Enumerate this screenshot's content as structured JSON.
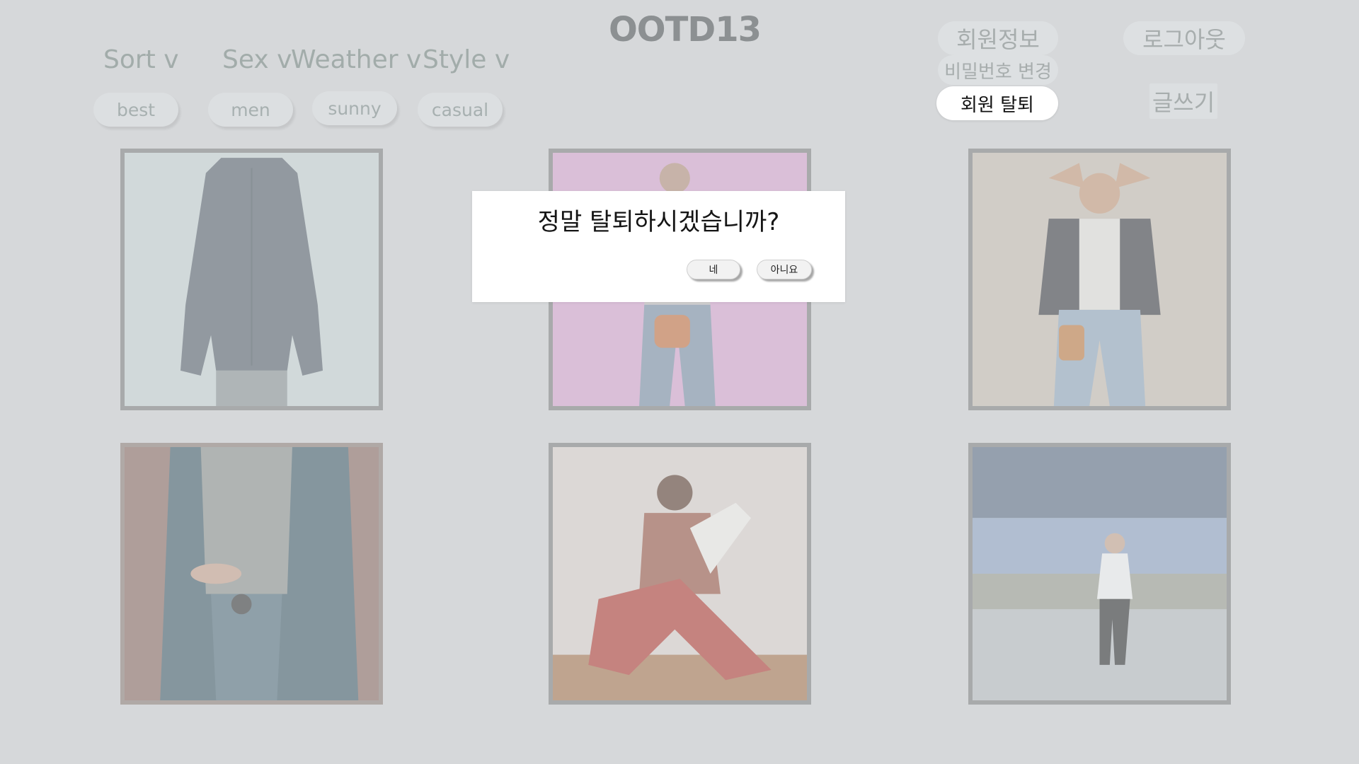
{
  "app": {
    "title": "OOTD13"
  },
  "filters": [
    {
      "label": "Sort v",
      "chip": "best"
    },
    {
      "label": "Sex v",
      "chip": "men"
    },
    {
      "label": "Weather v",
      "chip": "sunny"
    },
    {
      "label": "Style v",
      "chip": "casual"
    }
  ],
  "account_menu": {
    "profile": "회원정보",
    "change_password": "비밀번호 변경",
    "withdraw": "회원 탈퇴",
    "logout": "로그아웃",
    "write": "글쓰기"
  },
  "dialog": {
    "message": "정말 탈퇴하시겠습니까?",
    "yes": "네",
    "no": "아니요"
  },
  "colors": {
    "background": "#d6d8da",
    "frame": "#a8aaab",
    "active_pill": "#ffffff"
  }
}
